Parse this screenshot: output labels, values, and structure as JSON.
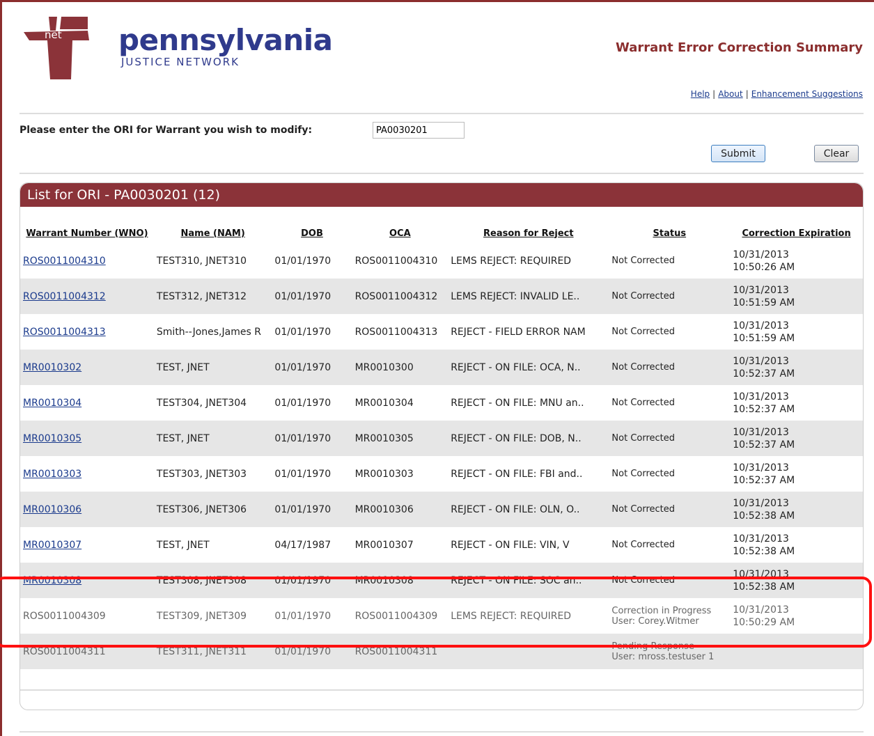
{
  "logo": {
    "mark": "net",
    "main": "pennsylvania",
    "sub": "JUSTICE NETWORK"
  },
  "page_title": "Warrant Error Correction Summary",
  "links": {
    "help": "Help",
    "about": "About",
    "enhancements": "Enhancement Suggestions",
    "separator": "|"
  },
  "form": {
    "label": "Please enter the ORI for Warrant you wish to modify:",
    "ori_value": "PA0030201",
    "submit_label": "Submit",
    "clear_label": "Clear"
  },
  "panel": {
    "title": "List for ORI - PA0030201 (12)"
  },
  "columns": [
    "Warrant Number (WNO)",
    "Name (NAM)",
    "DOB",
    "OCA",
    "Reason for Reject",
    "Status",
    "Correction Expiration"
  ],
  "rows": [
    {
      "wno": "ROS0011004310",
      "name": "TEST310, JNET310",
      "dob": "01/01/1970",
      "oca": "ROS0011004310",
      "reason": "LEMS  REJECT:  REQUIRED",
      "status": "Not Corrected",
      "exp_date": "10/31/2013",
      "exp_time": "10:50:26 AM"
    },
    {
      "wno": "ROS0011004312",
      "name": "TEST312, JNET312",
      "dob": "01/01/1970",
      "oca": "ROS0011004312",
      "reason": "LEMS REJECT: INVALID LE..",
      "status": "Not Corrected",
      "exp_date": "10/31/2013",
      "exp_time": "10:51:59 AM"
    },
    {
      "wno": "ROS0011004313",
      "name": "Smith--Jones,James R",
      "dob": "01/01/1970",
      "oca": "ROS0011004313",
      "reason": "REJECT - FIELD ERROR NAM",
      "status": "Not Corrected",
      "exp_date": "10/31/2013",
      "exp_time": "10:51:59 AM"
    },
    {
      "wno": "MR0010302",
      "name": "TEST, JNET",
      "dob": "01/01/1970",
      "oca": "MR0010300",
      "reason": "REJECT - ON FILE: OCA, N..",
      "status": "Not Corrected",
      "exp_date": "10/31/2013",
      "exp_time": "10:52:37 AM"
    },
    {
      "wno": "MR0010304",
      "name": "TEST304, JNET304",
      "dob": "01/01/1970",
      "oca": "MR0010304",
      "reason": "REJECT - ON FILE: MNU an..",
      "status": "Not Corrected",
      "exp_date": "10/31/2013",
      "exp_time": "10:52:37 AM"
    },
    {
      "wno": "MR0010305",
      "name": "TEST, JNET",
      "dob": "01/01/1970",
      "oca": "MR0010305",
      "reason": "REJECT - ON FILE: DOB, N..",
      "status": "Not Corrected",
      "exp_date": "10/31/2013",
      "exp_time": "10:52:37 AM"
    },
    {
      "wno": "MR0010303",
      "name": "TEST303, JNET303",
      "dob": "01/01/1970",
      "oca": "MR0010303",
      "reason": "REJECT - ON FILE: FBI and..",
      "status": "Not Corrected",
      "exp_date": "10/31/2013",
      "exp_time": "10:52:37 AM"
    },
    {
      "wno": "MR0010306",
      "name": "TEST306, JNET306",
      "dob": "01/01/1970",
      "oca": "MR0010306",
      "reason": "REJECT - ON FILE: OLN, O..",
      "status": "Not Corrected",
      "exp_date": "10/31/2013",
      "exp_time": "10:52:38 AM"
    },
    {
      "wno": "MR0010307",
      "name": "TEST, JNET",
      "dob": "04/17/1987",
      "oca": "MR0010307",
      "reason": "REJECT - ON FILE: VIN, V",
      "status": "Not Corrected",
      "exp_date": "10/31/2013",
      "exp_time": "10:52:38 AM"
    },
    {
      "wno": "MR0010308",
      "name": "TEST308, JNET308",
      "dob": "01/01/1970",
      "oca": "MR0010308",
      "reason": "REJECT - ON FILE: SOC an..",
      "status": "Not Corrected",
      "exp_date": "10/31/2013",
      "exp_time": "10:52:38 AM"
    },
    {
      "wno": "ROS0011004309",
      "name": "TEST309, JNET309",
      "dob": "01/01/1970",
      "oca": "ROS0011004309",
      "reason": "LEMS  REJECT:  REQUIRED",
      "status": "Correction in Progress",
      "status_user": "User: Corey.Witmer",
      "exp_date": "10/31/2013",
      "exp_time": "10:50:29 AM"
    },
    {
      "wno": "ROS0011004311",
      "name": "TEST311, JNET311",
      "dob": "01/01/1970",
      "oca": "ROS0011004311",
      "reason": "",
      "status": "Pending Response",
      "status_user": "User: mross.testuser 1",
      "exp_date": "",
      "exp_time": ""
    }
  ],
  "colors": {
    "brand": "#8b3339",
    "link": "#1a3a8c",
    "highlight": "#ff1010"
  }
}
